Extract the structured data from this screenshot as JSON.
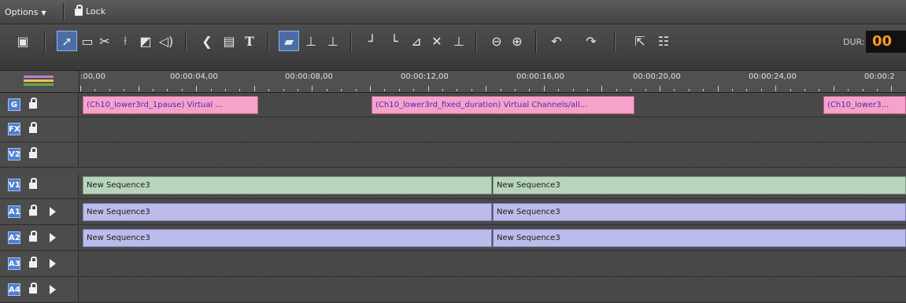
{
  "topbar": {
    "options_label": "Options",
    "lock_label": "Lock"
  },
  "toolbar": {
    "icons": [
      "save-icon",
      "select-arrow-icon",
      "trim-icon",
      "cut-scissors-icon",
      "split-icon",
      "matte-icon",
      "audio-icon",
      "link-icon",
      "effects-icon",
      "text-T-icon",
      "insert-icon",
      "overwrite-icon",
      "replace-icon",
      "lift-icon",
      "extract-icon",
      "ripple-icon",
      "delete-x-icon",
      "add-track-icon",
      "zoom-out-icon",
      "zoom-in-icon",
      "undo-icon",
      "redo-icon",
      "export-icon",
      "keyframe-icon"
    ],
    "dur_label": "DUR:",
    "dur_value": "00"
  },
  "ruler": {
    "labels": [
      ":00,00",
      "00:00:04,00",
      "00:00:08,00",
      "00:00:12,00",
      "00:00:16,00",
      "00:00:20,00",
      "00:00:24,00",
      "00:00:2"
    ]
  },
  "tracks": [
    {
      "badge": "G",
      "color": "#4f7fcf",
      "has_play": false,
      "clips": [
        {
          "type": "title",
          "label": "(Ch10_lower3rd_1pause) Virtual ..."
        },
        {
          "type": "title",
          "label": "(Ch10_lower3rd_fixed_duration) Virtual Channels/all..."
        },
        {
          "type": "title",
          "label": "(Ch10_lower3..."
        }
      ]
    },
    {
      "badge": "FX",
      "color": "#4f7fcf",
      "has_play": false,
      "clips": []
    },
    {
      "badge": "V2",
      "color": "#4f7fcf",
      "has_play": false,
      "clips": []
    },
    {
      "badge": "V1",
      "color": "#4f7fcf",
      "has_play": false,
      "clips": [
        {
          "type": "video",
          "label": "New Sequence3"
        },
        {
          "type": "video",
          "label": "New Sequence3"
        }
      ]
    },
    {
      "badge": "A1",
      "color": "#4f7fcf",
      "has_play": true,
      "clips": [
        {
          "type": "audio",
          "label": "New Sequence3"
        },
        {
          "type": "audio",
          "label": "New Sequence3"
        }
      ]
    },
    {
      "badge": "A2",
      "color": "#4f7fcf",
      "has_play": true,
      "clips": [
        {
          "type": "audio",
          "label": "New Sequence3"
        },
        {
          "type": "audio",
          "label": "New Sequence3"
        }
      ]
    },
    {
      "badge": "A3",
      "color": "#4f7fcf",
      "has_play": true,
      "clips": []
    },
    {
      "badge": "A4",
      "color": "#4f7fcf",
      "has_play": true,
      "clips": []
    }
  ]
}
